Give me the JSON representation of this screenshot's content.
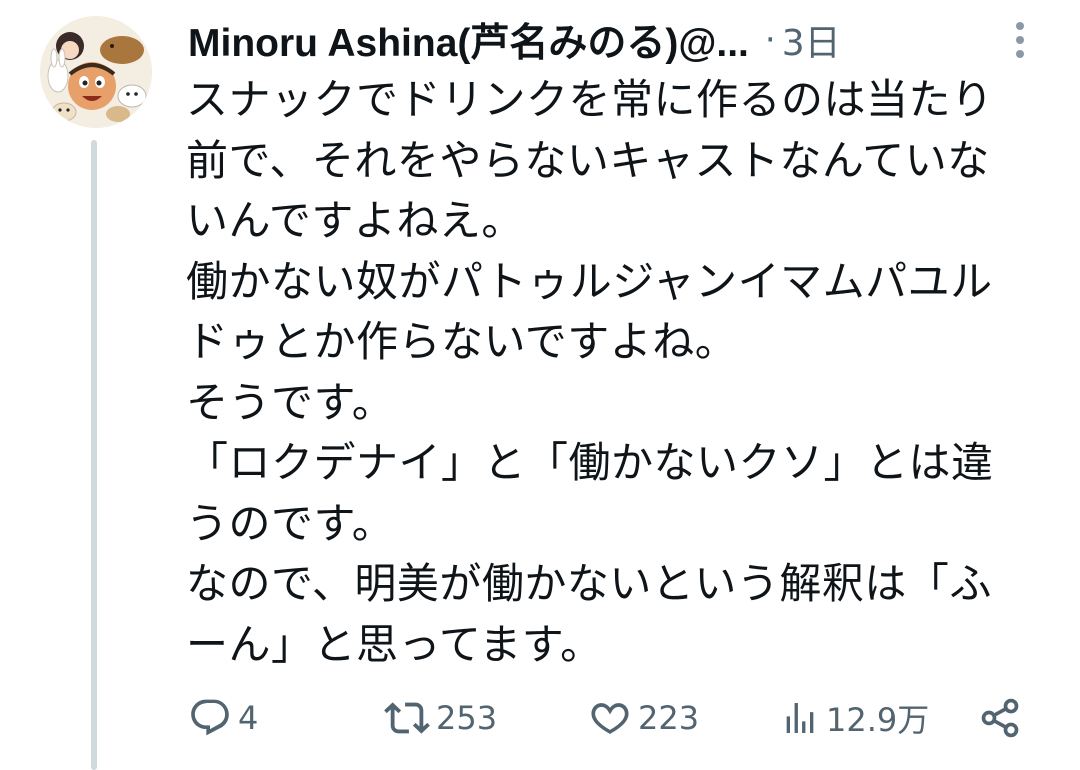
{
  "tweet": {
    "author": {
      "display_name": "Minoru Ashina(芦名みのる)@..."
    },
    "separator": "·",
    "timestamp": "3日",
    "body_lines": [
      "スナックでドリンクを常に作るのは当たり",
      "前で、それをやらないキャストなんていな",
      "いんですよねえ。",
      "働かない奴がパトゥルジャンイマムパユル",
      "ドゥとか作らないですよね。",
      "そうです。",
      "「ロクデナイ」と「働かないクソ」とは違",
      "うのです。",
      "なので、明美が働かないという解釈は「ふ",
      "ーん」と思ってます。"
    ],
    "actions": {
      "reply_count": "4",
      "retweet_count": "253",
      "like_count": "223",
      "view_count": "12.9万"
    }
  },
  "colors": {
    "text": "#0f1419",
    "secondary": "#536471",
    "thread_line": "#cfd9de",
    "background": "#ffffff"
  },
  "icons": [
    "reply-icon",
    "retweet-icon",
    "like-icon",
    "views-icon",
    "share-icon",
    "more-options-icon"
  ]
}
